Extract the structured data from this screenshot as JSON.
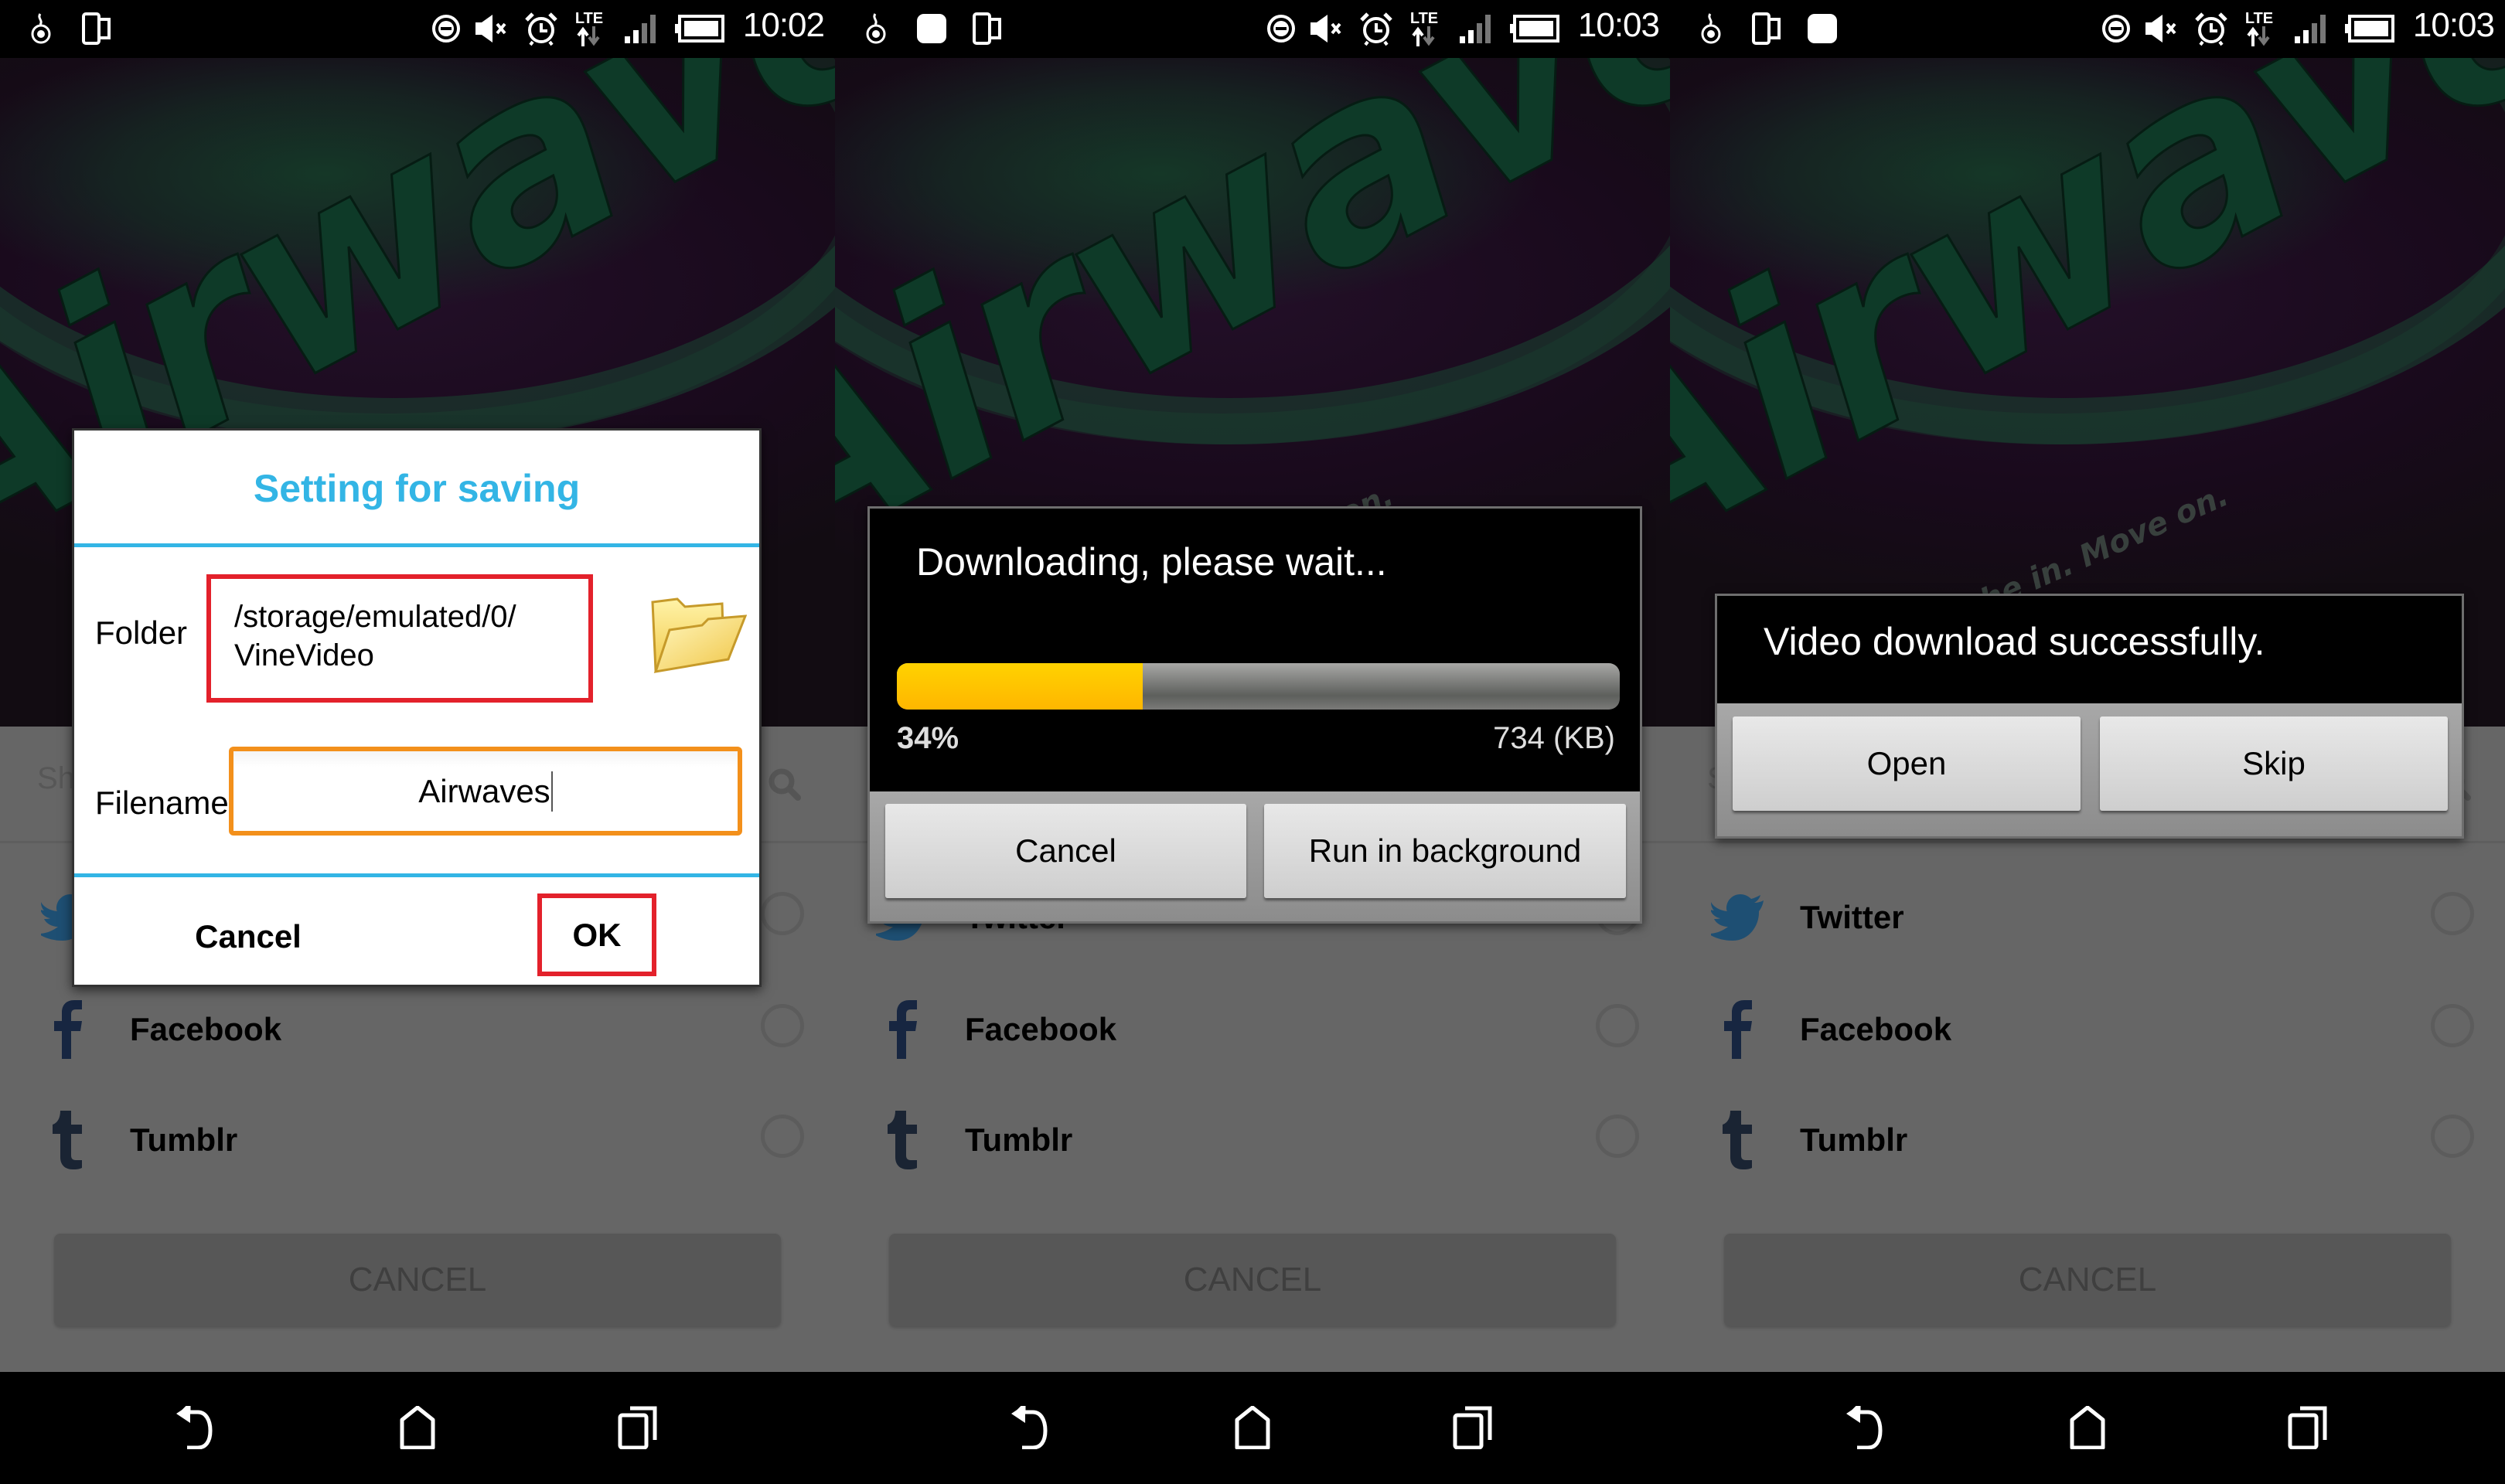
{
  "screens": [
    {
      "status_bar": {
        "time": "10:02",
        "left_icons": [
          "notification-app-icon",
          "screen-rotate-icon"
        ],
        "right_icons": [
          "do-not-disturb-icon",
          "mute-icon",
          "alarm-icon",
          "lte-data-icon",
          "signal-icon",
          "battery-icon"
        ]
      },
      "dialog": {
        "title": "Setting for saving",
        "folder_label": "Folder",
        "folder_value_line1": "/storage/emulated/0/",
        "folder_value_line2": "VineVideo",
        "filename_label": "Filename",
        "filename_value": "Airwaves",
        "cancel_label": "Cancel",
        "ok_label": "OK"
      }
    },
    {
      "status_bar": {
        "time": "10:03",
        "left_icons": [
          "notification-app-icon",
          "notification-square-icon",
          "screen-rotate-icon"
        ],
        "right_icons": [
          "do-not-disturb-icon",
          "mute-icon",
          "alarm-icon",
          "lte-data-icon",
          "signal-icon",
          "battery-icon"
        ]
      },
      "dialog": {
        "message": "Downloading, please wait...",
        "progress_percent": 34,
        "progress_label": "34%",
        "size_label": "734 (KB)",
        "cancel_label": "Cancel",
        "background_label": "Run in background"
      }
    },
    {
      "status_bar": {
        "time": "10:03",
        "left_icons": [
          "notification-app-icon",
          "screen-rotate-icon",
          "notification-square-icon"
        ],
        "right_icons": [
          "do-not-disturb-icon",
          "mute-icon",
          "alarm-icon",
          "lte-data-icon",
          "signal-icon",
          "battery-icon"
        ]
      },
      "dialog": {
        "message": "Video download successfully.",
        "open_label": "Open",
        "skip_label": "Skip"
      }
    }
  ],
  "hero": {
    "brand_text": "Airwaves",
    "tagline": "Breathe in. Move on."
  },
  "share_sheet": {
    "search_placeholder": "Share with a friend?",
    "items": [
      {
        "label": "Twitter",
        "icon": "twitter-icon",
        "color": "#1e4f73"
      },
      {
        "label": "Facebook",
        "icon": "facebook-icon",
        "color": "#172641"
      },
      {
        "label": "Tumblr",
        "icon": "tumblr-icon",
        "color": "#1a2433"
      }
    ],
    "cancel_label": "CANCEL"
  },
  "lte_label": "LTE",
  "colors": {
    "accent_blue": "#33b5e5",
    "highlight_red": "#e3212b",
    "input_orange": "#f3901b",
    "progress_yellow": "#ffc400",
    "overlay_gray": "#666666"
  }
}
